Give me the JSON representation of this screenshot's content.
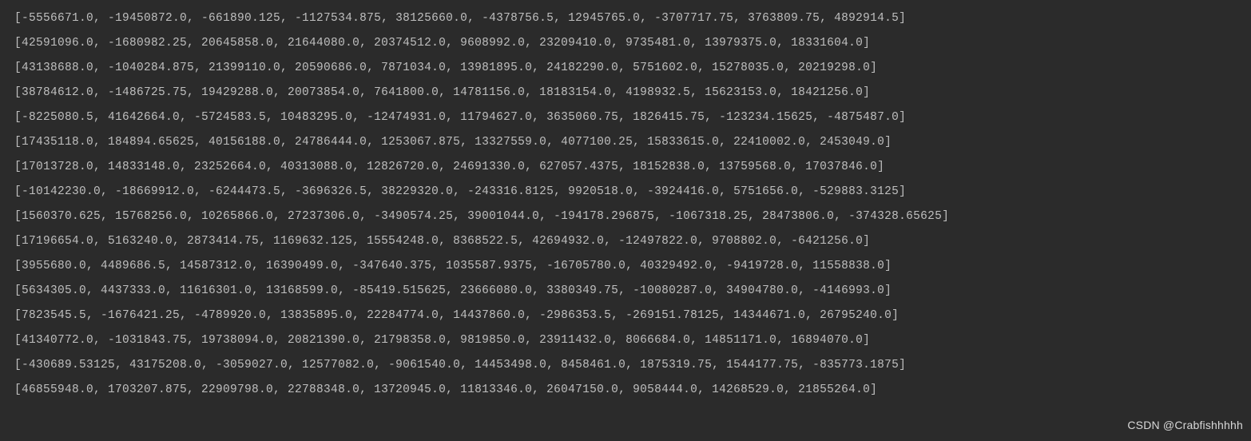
{
  "console": {
    "lines": [
      "[-5556671.0, -19450872.0, -661890.125, -1127534.875, 38125660.0, -4378756.5, 12945765.0, -3707717.75, 3763809.75, 4892914.5]",
      "[42591096.0, -1680982.25, 20645858.0, 21644080.0, 20374512.0, 9608992.0, 23209410.0, 9735481.0, 13979375.0, 18331604.0]",
      "[43138688.0, -1040284.875, 21399110.0, 20590686.0, 7871034.0, 13981895.0, 24182290.0, 5751602.0, 15278035.0, 20219298.0]",
      "[38784612.0, -1486725.75, 19429288.0, 20073854.0, 7641800.0, 14781156.0, 18183154.0, 4198932.5, 15623153.0, 18421256.0]",
      "[-8225080.5, 41642664.0, -5724583.5, 10483295.0, -12474931.0, 11794627.0, 3635060.75, 1826415.75, -123234.15625, -4875487.0]",
      "[17435118.0, 184894.65625, 40156188.0, 24786444.0, 1253067.875, 13327559.0, 4077100.25, 15833615.0, 22410002.0, 2453049.0]",
      "[17013728.0, 14833148.0, 23252664.0, 40313088.0, 12826720.0, 24691330.0, 627057.4375, 18152838.0, 13759568.0, 17037846.0]",
      "[-10142230.0, -18669912.0, -6244473.5, -3696326.5, 38229320.0, -243316.8125, 9920518.0, -3924416.0, 5751656.0, -529883.3125]",
      "[1560370.625, 15768256.0, 10265866.0, 27237306.0, -3490574.25, 39001044.0, -194178.296875, -1067318.25, 28473806.0, -374328.65625]",
      "[17196654.0, 5163240.0, 2873414.75, 1169632.125, 15554248.0, 8368522.5, 42694932.0, -12497822.0, 9708802.0, -6421256.0]",
      "[3955680.0, 4489686.5, 14587312.0, 16390499.0, -347640.375, 1035587.9375, -16705780.0, 40329492.0, -9419728.0, 11558838.0]",
      "[5634305.0, 4437333.0, 11616301.0, 13168599.0, -85419.515625, 23666080.0, 3380349.75, -10080287.0, 34904780.0, -4146993.0]",
      "[7823545.5, -1676421.25, -4789920.0, 13835895.0, 22284774.0, 14437860.0, -2986353.5, -269151.78125, 14344671.0, 26795240.0]",
      "[41340772.0, -1031843.75, 19738094.0, 20821390.0, 21798358.0, 9819850.0, 23911432.0, 8066684.0, 14851171.0, 16894070.0]",
      "[-430689.53125, 43175208.0, -3059027.0, 12577082.0, -9061540.0, 14453498.0, 8458461.0, 1875319.75, 1544177.75, -835773.1875]",
      "[46855948.0, 1703207.875, 22909798.0, 22788348.0, 13720945.0, 11813346.0, 26047150.0, 9058444.0, 14268529.0, 21855264.0]"
    ]
  },
  "watermark": "CSDN @Crabfishhhhh"
}
